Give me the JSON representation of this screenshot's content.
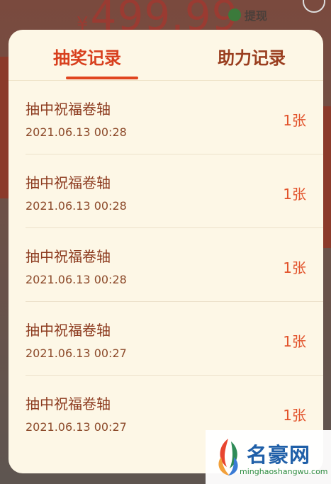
{
  "background": {
    "currency": "¥",
    "amount": "499.99",
    "withdraw_label": "提现"
  },
  "tabs": [
    {
      "label": "抽奖记录",
      "active": true
    },
    {
      "label": "助力记录",
      "active": false
    }
  ],
  "records": [
    {
      "title": "抽中祝福卷轴",
      "time": "2021.06.13 00:28",
      "quantity": "1张"
    },
    {
      "title": "抽中祝福卷轴",
      "time": "2021.06.13 00:28",
      "quantity": "1张"
    },
    {
      "title": "抽中祝福卷轴",
      "time": "2021.06.13 00:28",
      "quantity": "1张"
    },
    {
      "title": "抽中祝福卷轴",
      "time": "2021.06.13 00:27",
      "quantity": "1张"
    },
    {
      "title": "抽中祝福卷轴",
      "time": "2021.06.13 00:27",
      "quantity": "1张"
    }
  ],
  "watermark": {
    "brand": "名豪网",
    "domain": "minghaoshangwu.com"
  },
  "colors": {
    "accent": "#e0451f",
    "text_primary": "#8c3a1e",
    "modal_bg": "#fdf7e6"
  }
}
